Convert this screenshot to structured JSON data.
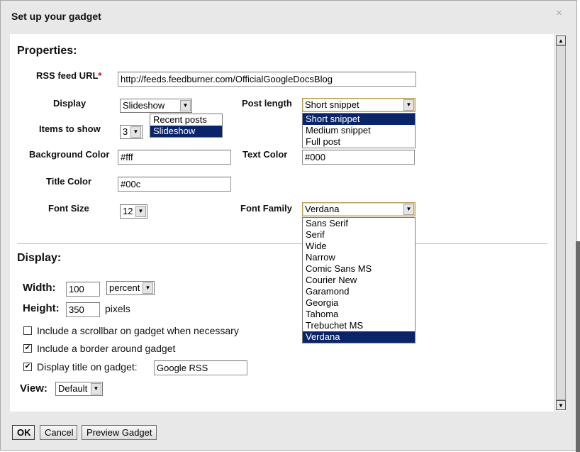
{
  "dialog": {
    "title": "Set up your gadget",
    "close_label": "×"
  },
  "properties": {
    "section_title": "Properties:",
    "rss_feed_url": {
      "label": "RSS feed URL",
      "required_mark": "*",
      "value": "http://feeds.feedburner.com/OfficialGoogleDocsBlog"
    },
    "display": {
      "label": "Display",
      "selected": "Slideshow",
      "options": [
        "Recent posts",
        "Slideshow"
      ]
    },
    "items_to_show": {
      "label": "Items to show",
      "selected": "3"
    },
    "background_color": {
      "label": "Background Color",
      "value": "#fff"
    },
    "title_color": {
      "label": "Title Color",
      "value": "#00c"
    },
    "font_size": {
      "label": "Font Size",
      "selected": "12"
    },
    "post_length": {
      "label": "Post length",
      "selected": "Short snippet",
      "options": [
        "Short snippet",
        "Medium snippet",
        "Full post"
      ]
    },
    "text_color": {
      "label": "Text Color",
      "value": "#000"
    },
    "font_family": {
      "label": "Font Family",
      "selected": "Verdana",
      "options": [
        "Sans Serif",
        "Serif",
        "Wide",
        "Narrow",
        "Comic Sans MS",
        "Courier New",
        "Garamond",
        "Georgia",
        "Tahoma",
        "Trebuchet MS",
        "Verdana"
      ]
    }
  },
  "display_section": {
    "section_title": "Display:",
    "width": {
      "label": "Width:",
      "value": "100",
      "unit_selected": "percent"
    },
    "height": {
      "label": "Height:",
      "value": "350",
      "unit": "pixels"
    },
    "scrollbar_option": {
      "label": "Include a scrollbar on gadget when necessary",
      "checked": false
    },
    "border_option": {
      "label": "Include a border around gadget",
      "checked": true
    },
    "title_option": {
      "label": "Display title on gadget:",
      "checked": true,
      "value": "Google RSS"
    },
    "view": {
      "label": "View:",
      "selected": "Default"
    }
  },
  "buttons": {
    "ok": "OK",
    "cancel": "Cancel",
    "preview": "Preview Gadget"
  },
  "icons": {
    "check": "✔",
    "dropdown_arrow": "▼",
    "scroll_up": "▲",
    "scroll_down": "▼"
  },
  "colors": {
    "highlight": "#0a246a",
    "required": "#cc0000",
    "focus_border": "#b59a5a"
  }
}
